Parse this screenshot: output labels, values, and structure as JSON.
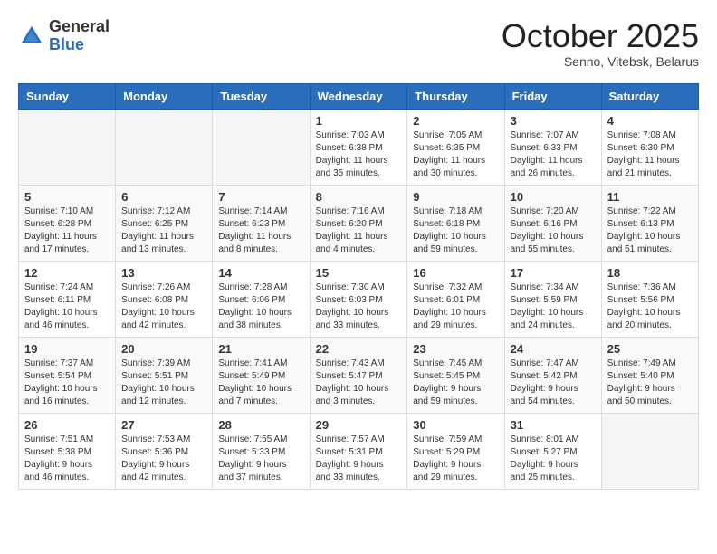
{
  "logo": {
    "general": "General",
    "blue": "Blue"
  },
  "header": {
    "month": "October 2025",
    "location": "Senno, Vitebsk, Belarus"
  },
  "weekdays": [
    "Sunday",
    "Monday",
    "Tuesday",
    "Wednesday",
    "Thursday",
    "Friday",
    "Saturday"
  ],
  "weeks": [
    [
      {
        "day": "",
        "info": ""
      },
      {
        "day": "",
        "info": ""
      },
      {
        "day": "",
        "info": ""
      },
      {
        "day": "1",
        "info": "Sunrise: 7:03 AM\nSunset: 6:38 PM\nDaylight: 11 hours\nand 35 minutes."
      },
      {
        "day": "2",
        "info": "Sunrise: 7:05 AM\nSunset: 6:35 PM\nDaylight: 11 hours\nand 30 minutes."
      },
      {
        "day": "3",
        "info": "Sunrise: 7:07 AM\nSunset: 6:33 PM\nDaylight: 11 hours\nand 26 minutes."
      },
      {
        "day": "4",
        "info": "Sunrise: 7:08 AM\nSunset: 6:30 PM\nDaylight: 11 hours\nand 21 minutes."
      }
    ],
    [
      {
        "day": "5",
        "info": "Sunrise: 7:10 AM\nSunset: 6:28 PM\nDaylight: 11 hours\nand 17 minutes."
      },
      {
        "day": "6",
        "info": "Sunrise: 7:12 AM\nSunset: 6:25 PM\nDaylight: 11 hours\nand 13 minutes."
      },
      {
        "day": "7",
        "info": "Sunrise: 7:14 AM\nSunset: 6:23 PM\nDaylight: 11 hours\nand 8 minutes."
      },
      {
        "day": "8",
        "info": "Sunrise: 7:16 AM\nSunset: 6:20 PM\nDaylight: 11 hours\nand 4 minutes."
      },
      {
        "day": "9",
        "info": "Sunrise: 7:18 AM\nSunset: 6:18 PM\nDaylight: 10 hours\nand 59 minutes."
      },
      {
        "day": "10",
        "info": "Sunrise: 7:20 AM\nSunset: 6:16 PM\nDaylight: 10 hours\nand 55 minutes."
      },
      {
        "day": "11",
        "info": "Sunrise: 7:22 AM\nSunset: 6:13 PM\nDaylight: 10 hours\nand 51 minutes."
      }
    ],
    [
      {
        "day": "12",
        "info": "Sunrise: 7:24 AM\nSunset: 6:11 PM\nDaylight: 10 hours\nand 46 minutes."
      },
      {
        "day": "13",
        "info": "Sunrise: 7:26 AM\nSunset: 6:08 PM\nDaylight: 10 hours\nand 42 minutes."
      },
      {
        "day": "14",
        "info": "Sunrise: 7:28 AM\nSunset: 6:06 PM\nDaylight: 10 hours\nand 38 minutes."
      },
      {
        "day": "15",
        "info": "Sunrise: 7:30 AM\nSunset: 6:03 PM\nDaylight: 10 hours\nand 33 minutes."
      },
      {
        "day": "16",
        "info": "Sunrise: 7:32 AM\nSunset: 6:01 PM\nDaylight: 10 hours\nand 29 minutes."
      },
      {
        "day": "17",
        "info": "Sunrise: 7:34 AM\nSunset: 5:59 PM\nDaylight: 10 hours\nand 24 minutes."
      },
      {
        "day": "18",
        "info": "Sunrise: 7:36 AM\nSunset: 5:56 PM\nDaylight: 10 hours\nand 20 minutes."
      }
    ],
    [
      {
        "day": "19",
        "info": "Sunrise: 7:37 AM\nSunset: 5:54 PM\nDaylight: 10 hours\nand 16 minutes."
      },
      {
        "day": "20",
        "info": "Sunrise: 7:39 AM\nSunset: 5:51 PM\nDaylight: 10 hours\nand 12 minutes."
      },
      {
        "day": "21",
        "info": "Sunrise: 7:41 AM\nSunset: 5:49 PM\nDaylight: 10 hours\nand 7 minutes."
      },
      {
        "day": "22",
        "info": "Sunrise: 7:43 AM\nSunset: 5:47 PM\nDaylight: 10 hours\nand 3 minutes."
      },
      {
        "day": "23",
        "info": "Sunrise: 7:45 AM\nSunset: 5:45 PM\nDaylight: 9 hours\nand 59 minutes."
      },
      {
        "day": "24",
        "info": "Sunrise: 7:47 AM\nSunset: 5:42 PM\nDaylight: 9 hours\nand 54 minutes."
      },
      {
        "day": "25",
        "info": "Sunrise: 7:49 AM\nSunset: 5:40 PM\nDaylight: 9 hours\nand 50 minutes."
      }
    ],
    [
      {
        "day": "26",
        "info": "Sunrise: 7:51 AM\nSunset: 5:38 PM\nDaylight: 9 hours\nand 46 minutes."
      },
      {
        "day": "27",
        "info": "Sunrise: 7:53 AM\nSunset: 5:36 PM\nDaylight: 9 hours\nand 42 minutes."
      },
      {
        "day": "28",
        "info": "Sunrise: 7:55 AM\nSunset: 5:33 PM\nDaylight: 9 hours\nand 37 minutes."
      },
      {
        "day": "29",
        "info": "Sunrise: 7:57 AM\nSunset: 5:31 PM\nDaylight: 9 hours\nand 33 minutes."
      },
      {
        "day": "30",
        "info": "Sunrise: 7:59 AM\nSunset: 5:29 PM\nDaylight: 9 hours\nand 29 minutes."
      },
      {
        "day": "31",
        "info": "Sunrise: 8:01 AM\nSunset: 5:27 PM\nDaylight: 9 hours\nand 25 minutes."
      },
      {
        "day": "",
        "info": ""
      }
    ]
  ]
}
